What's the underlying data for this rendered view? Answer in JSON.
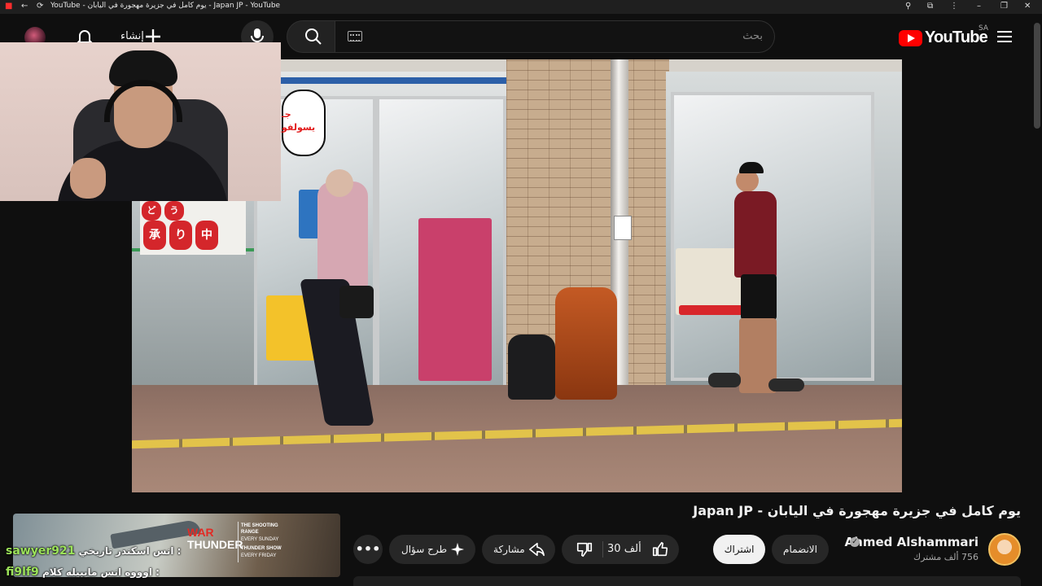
{
  "browser": {
    "tab_title": "YouTube - يوم كامل في جزيرة مهجورة في اليابان - Japan JP - YouTube"
  },
  "header": {
    "logo_text": "YouTube",
    "region": "SA",
    "search_placeholder": "بحث",
    "create_label": "إنشاء"
  },
  "video": {
    "title": "يوم كامل في جزيرة مهجورة في اليابان - Japan JP",
    "lanterns": [
      "ど",
      "う",
      "承",
      "り",
      "中"
    ],
    "overlay_bubble": [
      "جـ",
      "يسولفو"
    ]
  },
  "channel": {
    "name": "Ahmed Alshammari",
    "subscribers": "756 ألف مشترك",
    "join_label": "الانضمام",
    "subscribe_label": "اشتراك"
  },
  "actions": {
    "like_count": "30 ألف",
    "share_label": "مشاركة",
    "ask_label": "طرح سؤال"
  },
  "stream_overlay": {
    "ad": {
      "logo_line1": "WAR",
      "logo_line2": "THUNDER",
      "lines": [
        "THE SHOOTING",
        "RANGE",
        "EVERY SUNDAY",
        "THUNDER SHOW",
        "EVERY FRIDAY"
      ]
    },
    "chat": [
      {
        "user": "sawyer921",
        "message": "انس اسكندر تاريخي :"
      },
      {
        "user": "fi9lf9",
        "message": "اوووه انس مايبيله كلام :"
      }
    ]
  }
}
